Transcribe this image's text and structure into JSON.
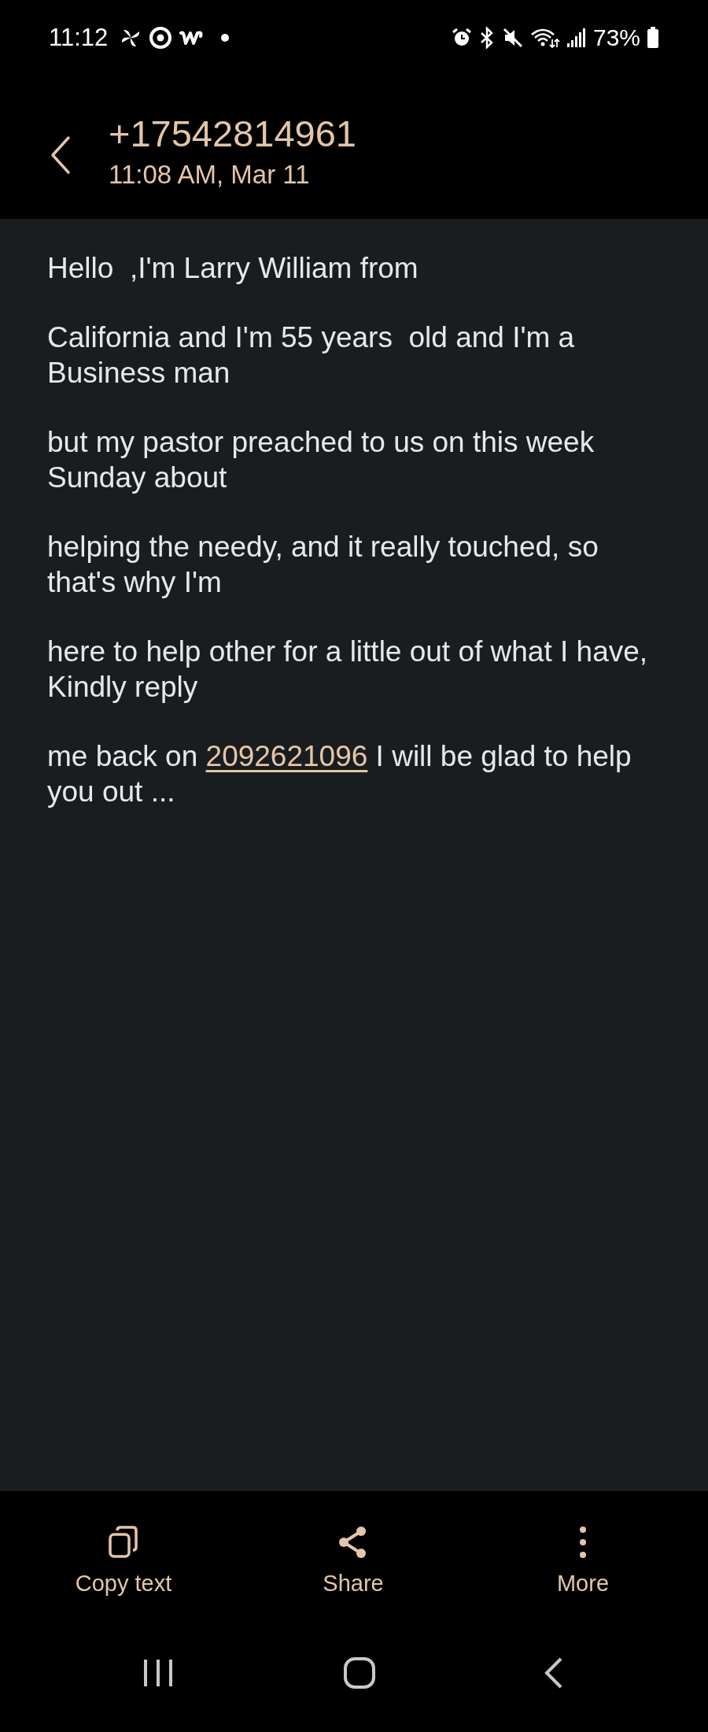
{
  "status_bar": {
    "time": "11:12",
    "battery": "73%"
  },
  "header": {
    "title": "+17542814961",
    "subtitle": "11:08 AM, Mar 11"
  },
  "message": {
    "paragraphs": [
      {
        "lines": [
          [
            {
              "kind": "text",
              "text": "Hello  ,I'm Larry William from"
            }
          ]
        ]
      },
      {
        "lines": [
          [
            {
              "kind": "text",
              "text": "California and I'm 55 years  old and I'm a"
            }
          ],
          [
            {
              "kind": "text",
              "text": "Business man"
            }
          ]
        ]
      },
      {
        "lines": [
          [
            {
              "kind": "text",
              "text": "but my pastor preached to us on this week"
            }
          ],
          [
            {
              "kind": "text",
              "text": "Sunday about"
            }
          ]
        ]
      },
      {
        "lines": [
          [
            {
              "kind": "text",
              "text": "helping the needy, and it really touched, so"
            }
          ],
          [
            {
              "kind": "text",
              "text": "that's why I'm"
            }
          ]
        ]
      },
      {
        "lines": [
          [
            {
              "kind": "text",
              "text": "here to help other for a little out of what I have,"
            }
          ],
          [
            {
              "kind": "text",
              "text": "Kindly reply"
            }
          ]
        ]
      },
      {
        "lines": [
          [
            {
              "kind": "text",
              "text": "me back on "
            },
            {
              "kind": "link",
              "text": "2092621096"
            },
            {
              "kind": "text",
              "text": " I will be glad to help"
            }
          ],
          [
            {
              "kind": "text",
              "text": "you out ..."
            }
          ]
        ]
      }
    ]
  },
  "actions": [
    {
      "kind": "copy",
      "label": "Copy text"
    },
    {
      "kind": "share",
      "label": "Share"
    },
    {
      "kind": "more",
      "label": "More"
    }
  ]
}
